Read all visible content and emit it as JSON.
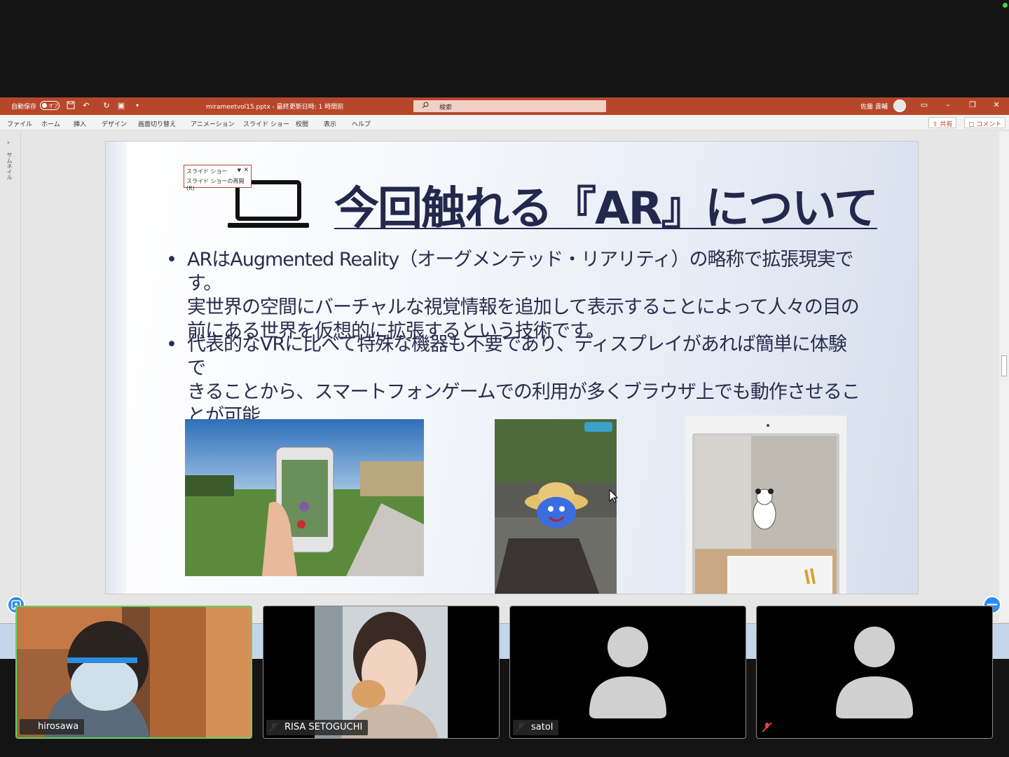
{
  "window": {
    "autosave_label": "自動保存",
    "autosave_state": "オフ",
    "file_title": "mirameetvol15.pptx - 最終更新日時: 1 時間前",
    "search_placeholder": "検索",
    "user_name": "佐藤 貴輔"
  },
  "menu": {
    "items": [
      "ファイル",
      "ホーム",
      "挿入",
      "デザイン",
      "画面切り替え",
      "アニメーション",
      "スライド ショー",
      "校閲",
      "表示",
      "ヘルプ"
    ],
    "share_label": "共有",
    "comment_label": "コメント"
  },
  "sidepane": {
    "label": "サムネイル"
  },
  "slideshow_popup": {
    "title": "スライド ショー",
    "resume": "スライド ショーの再開(R)"
  },
  "slide": {
    "title": "今回触れる『AR』について",
    "bullets": [
      "ARはAugmented Reality（オーグメンテッド・リアリティ）の略称で拡張現実です。\n実世界の空間にバーチャルな視覚情報を追加して表示することによって人々の目の\n前にある世界を仮想的に拡張するという技術です。",
      "代表的なVRに比べて特殊な機器も不要であり、ディスプレイがあれば簡単に体験で\nきることから、スマートフォンゲームでの利用が多くブラウザ上でも動作させることが可能\nです。"
    ],
    "bullet_char": "•"
  },
  "participants": [
    {
      "name": "hirosawa",
      "muted": true,
      "video": true,
      "active": true
    },
    {
      "name": "RISA SETOGUCHI",
      "muted": true,
      "video": true,
      "active": false
    },
    {
      "name": "satol",
      "muted": true,
      "video": false,
      "active": false
    },
    {
      "name": "",
      "muted": true,
      "video": false,
      "active": false
    }
  ],
  "colors": {
    "ppt_accent": "#b7472a",
    "active_speaker": "#5fd35f",
    "zoom_blue": "#2f8af5",
    "title_navy": "#23284d"
  }
}
